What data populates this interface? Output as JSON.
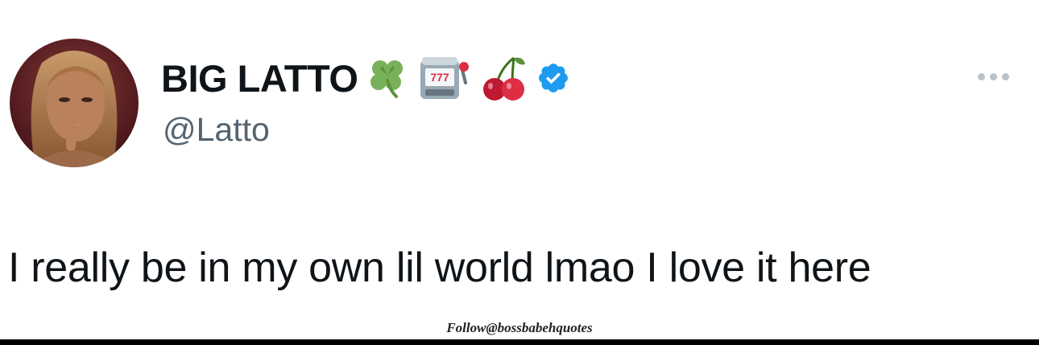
{
  "tweet": {
    "display_name": "BIG LATTO",
    "name_emojis": [
      "four-leaf-clover-icon",
      "slot-machine-icon",
      "cherries-icon"
    ],
    "slot_machine_text": "777",
    "verified_badge": "verified-badge-icon",
    "handle": "@Latto",
    "text": "I really be in my own lil world lmao I love it here",
    "more_icon": "more-options-icon"
  },
  "watermark": {
    "text": "Follow@bossbabehquotes"
  },
  "colors": {
    "background": "#ffffff",
    "text_primary": "#0f1419",
    "text_secondary": "#536471",
    "verified_blue": "#1d9bf0",
    "more_dots": "#b9c2ca"
  }
}
